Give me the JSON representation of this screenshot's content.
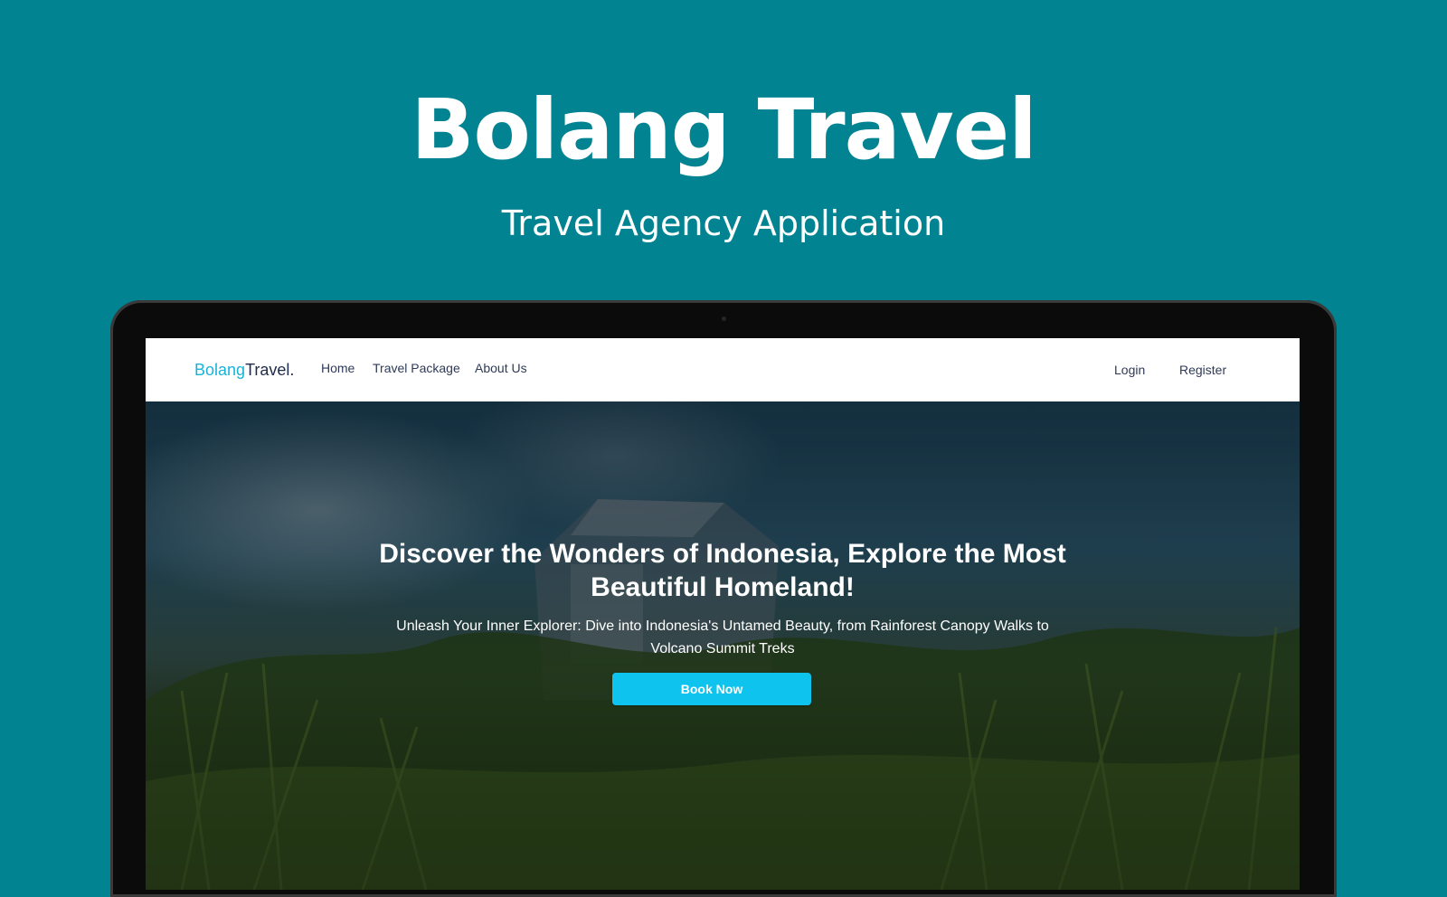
{
  "promo": {
    "title": "Bolang Travel",
    "subtitle": "Travel Agency Application"
  },
  "site": {
    "logo_part1": "Bolang",
    "logo_part2": "Travel.",
    "nav": {
      "home": "Home",
      "travel_package": "Travel Package",
      "about_us": "About Us",
      "login": "Login",
      "register": "Register"
    },
    "hero": {
      "title": "Discover the Wonders of Indonesia, Explore the Most Beautiful Homeland!",
      "text": "Unleash Your Inner Explorer: Dive into Indonesia's Untamed Beauty, from Rainforest Canopy Walks to Volcano Summit Treks",
      "button": "Book Now"
    }
  },
  "colors": {
    "background": "#028391",
    "logo_accent": "#17b3d9",
    "logo_dark": "#1e2b4a",
    "button": "#0ec4ee"
  }
}
